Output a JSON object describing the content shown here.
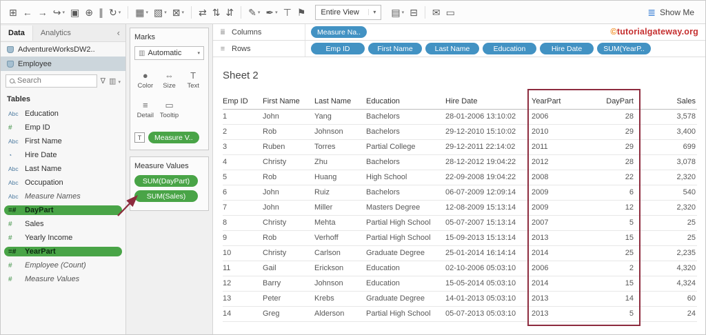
{
  "colors": {
    "pill_blue": "#4292c3",
    "pill_green": "#49a447",
    "highlight_red": "#8d2b3e",
    "watermark_orange": "#f08b1d",
    "watermark_red": "#c53030",
    "showme_blue": "#3a7fd5",
    "dimension_icon": "#4d7ba0",
    "measure_icon": "#3f9146"
  },
  "toolbar": {
    "icons_left": [
      {
        "name": "tableau-grid",
        "glyph": "⊞"
      },
      {
        "name": "undo",
        "glyph": "←"
      },
      {
        "name": "redo",
        "glyph": "→"
      },
      {
        "name": "replay",
        "glyph": "↪",
        "caret": true
      },
      {
        "name": "save",
        "glyph": "▣"
      },
      {
        "name": "new-data-source",
        "glyph": "⊕"
      },
      {
        "name": "pause-auto-updates",
        "glyph": "∥"
      },
      {
        "name": "run-update",
        "glyph": "↻",
        "caret": true
      },
      {
        "name": "sep"
      },
      {
        "name": "new-worksheet",
        "glyph": "▦",
        "caret": true
      },
      {
        "name": "duplicate-sheet",
        "glyph": "▧",
        "caret": true
      },
      {
        "name": "clear-sheet",
        "glyph": "⊠",
        "caret": true
      },
      {
        "name": "sep"
      },
      {
        "name": "swap-rows-columns",
        "glyph": "⇄"
      },
      {
        "name": "sort-ascending",
        "glyph": "⇅"
      },
      {
        "name": "sort-descending",
        "glyph": "⇵"
      },
      {
        "name": "sep"
      },
      {
        "name": "highlight",
        "glyph": "✎",
        "caret": true
      },
      {
        "name": "annotate",
        "glyph": "✒",
        "caret": true
      },
      {
        "name": "text-label",
        "glyph": "⊤"
      },
      {
        "name": "fix-axes",
        "glyph": "⚑"
      }
    ],
    "view_mode": "Entire View",
    "icons_right": [
      {
        "name": "show-mark-labels",
        "glyph": "▤",
        "caret": true
      },
      {
        "name": "presentation-mode",
        "glyph": "⊟"
      },
      {
        "name": "sep"
      },
      {
        "name": "share",
        "glyph": "✉"
      },
      {
        "name": "tooltip-bubble",
        "glyph": "▭"
      }
    ],
    "show_me_label": "Show Me"
  },
  "sidebar": {
    "tabs": [
      {
        "label": "Data",
        "active": true
      },
      {
        "label": "Analytics",
        "active": false
      }
    ],
    "collapse_glyph": "‹",
    "datasources": [
      {
        "label": "AdventureWorksDW2..",
        "selected": false
      },
      {
        "label": "Employee",
        "selected": true
      }
    ],
    "search": {
      "placeholder": "Search"
    },
    "filter_icon": "∇",
    "view_options_icon": "▥",
    "tables_label": "Tables",
    "fields": [
      {
        "icon": "Abc",
        "kind": "string",
        "label": "Education"
      },
      {
        "icon": "#",
        "kind": "number",
        "label": "Emp ID"
      },
      {
        "icon": "Abc",
        "kind": "string",
        "label": "First Name"
      },
      {
        "icon": "◔",
        "kind": "datetime",
        "label": "Hire Date"
      },
      {
        "icon": "Abc",
        "kind": "string",
        "label": "Last Name"
      },
      {
        "icon": "Abc",
        "kind": "string",
        "label": "Occupation"
      },
      {
        "icon": "Abc",
        "kind": "string",
        "label": "Measure Names",
        "italic": true
      },
      {
        "icon": "=#",
        "kind": "number",
        "label": "DayPart",
        "highlighted": true
      },
      {
        "icon": "#",
        "kind": "number",
        "label": "Sales"
      },
      {
        "icon": "#",
        "kind": "number",
        "label": "Yearly Income"
      },
      {
        "icon": "=#",
        "kind": "number",
        "label": "YearPart",
        "highlighted": true
      },
      {
        "icon": "#",
        "kind": "number",
        "label": "Employee (Count)",
        "italic": true
      },
      {
        "icon": "#",
        "kind": "number",
        "label": "Measure Values",
        "italic": true
      }
    ]
  },
  "marks": {
    "title": "Marks",
    "mark_type": {
      "icon": "▥",
      "label": "Automatic"
    },
    "buttons": [
      {
        "name": "color",
        "icon": "●",
        "label": "Color"
      },
      {
        "name": "size",
        "icon": "⇔",
        "label": "Size"
      },
      {
        "name": "text",
        "icon": "T",
        "label": "Text"
      },
      {
        "name": "detail",
        "icon": "≡",
        "label": "Detail"
      },
      {
        "name": "tooltip",
        "icon": "▭",
        "label": "Tooltip"
      }
    ],
    "text_shelf": {
      "icon": "T",
      "pill": "Measure V.."
    }
  },
  "measure_values": {
    "title": "Measure Values",
    "pills": [
      "SUM(DayPart)",
      "SUM(Sales)"
    ]
  },
  "shelves": {
    "columns": {
      "icon": "ⅲ",
      "label": "Columns",
      "pills": [
        {
          "label": "Measure Na..",
          "color": "blue"
        }
      ]
    },
    "rows": {
      "icon": "≡",
      "label": "Rows",
      "pills": [
        {
          "label": "Emp ID",
          "color": "blue"
        },
        {
          "label": "First Name",
          "color": "blue"
        },
        {
          "label": "Last Name",
          "color": "blue"
        },
        {
          "label": "Education",
          "color": "blue"
        },
        {
          "label": "Hire Date",
          "color": "blue"
        },
        {
          "label": "SUM(YearP..",
          "color": "blue"
        }
      ]
    }
  },
  "watermark": {
    "prefix": "©",
    "text": "tutorialgateway.org"
  },
  "sheet": {
    "title": "Sheet 2",
    "table": {
      "columns": [
        {
          "label": "Emp ID",
          "align": "left"
        },
        {
          "label": "First Name",
          "align": "left"
        },
        {
          "label": "Last Name",
          "align": "left"
        },
        {
          "label": "Education",
          "align": "left"
        },
        {
          "label": "Hire Date",
          "align": "left"
        },
        {
          "label": "YearPart",
          "align": "left",
          "boxed": true
        },
        {
          "label": "DayPart",
          "align": "right",
          "boxed": true
        },
        {
          "label": "Sales",
          "align": "right"
        }
      ],
      "rows": [
        [
          "1",
          "John",
          "Yang",
          "Bachelors",
          "28-01-2006 13:10:02",
          "2006",
          "28",
          "3,578"
        ],
        [
          "2",
          "Rob",
          "Johnson",
          "Bachelors",
          "29-12-2010 15:10:02",
          "2010",
          "29",
          "3,400"
        ],
        [
          "3",
          "Ruben",
          "Torres",
          "Partial College",
          "29-12-2011 22:14:02",
          "2011",
          "29",
          "699"
        ],
        [
          "4",
          "Christy",
          "Zhu",
          "Bachelors",
          "28-12-2012 19:04:22",
          "2012",
          "28",
          "3,078"
        ],
        [
          "5",
          "Rob",
          "Huang",
          "High School",
          "22-09-2008 19:04:22",
          "2008",
          "22",
          "2,320"
        ],
        [
          "6",
          "John",
          "Ruiz",
          "Bachelors",
          "06-07-2009 12:09:14",
          "2009",
          "6",
          "540"
        ],
        [
          "7",
          "John",
          "Miller",
          "Masters Degree",
          "12-08-2009 15:13:14",
          "2009",
          "12",
          "2,320"
        ],
        [
          "8",
          "Christy",
          "Mehta",
          "Partial High School",
          "05-07-2007 15:13:14",
          "2007",
          "5",
          "25"
        ],
        [
          "9",
          "Rob",
          "Verhoff",
          "Partial High School",
          "15-09-2013 15:13:14",
          "2013",
          "15",
          "25"
        ],
        [
          "10",
          "Christy",
          "Carlson",
          "Graduate Degree",
          "25-01-2014 16:14:14",
          "2014",
          "25",
          "2,235"
        ],
        [
          "11",
          "Gail",
          "Erickson",
          "Education",
          "02-10-2006 05:03:10",
          "2006",
          "2",
          "4,320"
        ],
        [
          "12",
          "Barry",
          "Johnson",
          "Education",
          "15-05-2014 05:03:10",
          "2014",
          "15",
          "4,324"
        ],
        [
          "13",
          "Peter",
          "Krebs",
          "Graduate Degree",
          "14-01-2013 05:03:10",
          "2013",
          "14",
          "60"
        ],
        [
          "14",
          "Greg",
          "Alderson",
          "Partial High School",
          "05-07-2013 05:03:10",
          "2013",
          "5",
          "24"
        ]
      ]
    }
  }
}
